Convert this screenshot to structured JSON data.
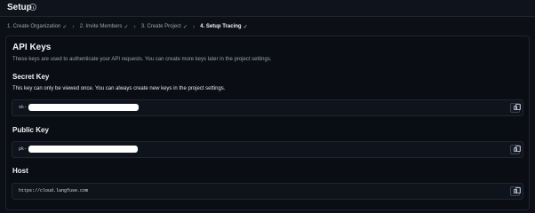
{
  "header": {
    "title": "Setup"
  },
  "steps": [
    {
      "label": "1. Create Organization",
      "done": true
    },
    {
      "label": "2. Invite Members",
      "done": true
    },
    {
      "label": "3. Create Project",
      "done": true
    },
    {
      "label": "4. Setup Tracing",
      "done": true,
      "active": true
    }
  ],
  "api_keys": {
    "title": "API Keys",
    "description": "These keys are used to authenticate your API requests. You can create more keys later in the project settings.",
    "secret": {
      "label": "Secret Key",
      "note": "This key can only be viewed once. You can always create new keys in the project settings.",
      "prefix": "sk-"
    },
    "public": {
      "label": "Public Key",
      "prefix": "pk-"
    },
    "host": {
      "label": "Host",
      "value": "https://cloud.langfuse.com"
    }
  },
  "colors": {
    "background": "#0c0f16",
    "card": "#0a0d14",
    "border": "#1f2531",
    "muted_text": "#9aa2b1"
  }
}
